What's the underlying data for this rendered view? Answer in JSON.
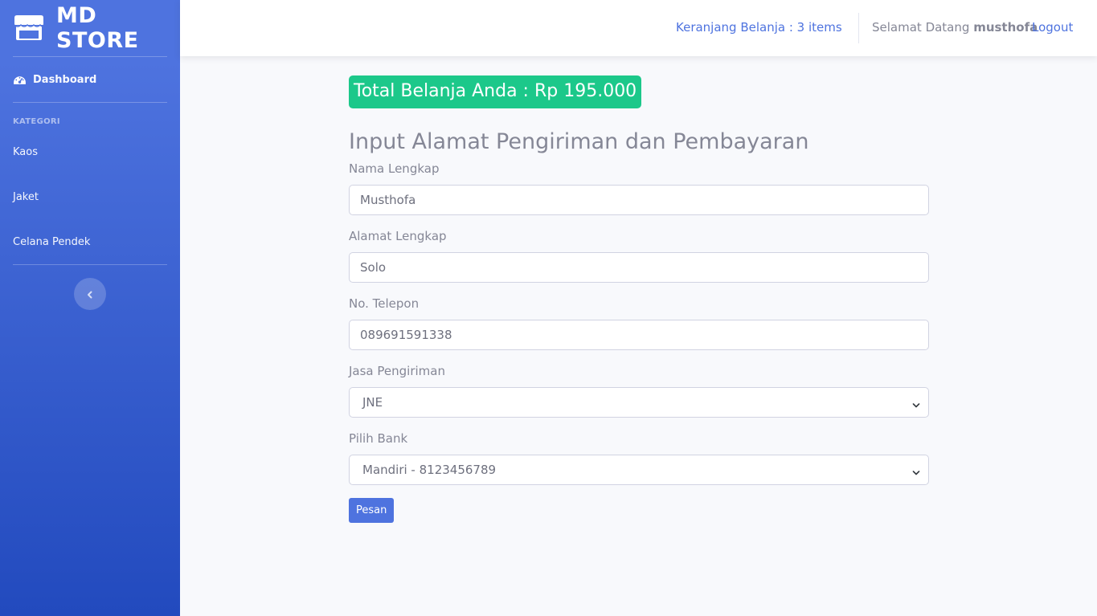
{
  "brand": {
    "name": "MD STORE",
    "icon": "store-icon"
  },
  "sidebar": {
    "dashboard": {
      "label": "Dashboard",
      "icon": "tachometer-icon"
    },
    "heading": "KATEGORI",
    "categories": [
      {
        "label": "Kaos"
      },
      {
        "label": "Jaket"
      },
      {
        "label": "Celana Pendek"
      }
    ],
    "toggle_icon": "chevron-left-icon"
  },
  "topbar": {
    "cart_label": "Keranjang Belanja : 3 items",
    "greeting_prefix": "Selamat Datang",
    "username": "musthofa",
    "logout_label": "Logout"
  },
  "main": {
    "total_label": "Total Belanja Anda : Rp 195.000",
    "form_title": "Input Alamat Pengiriman dan Pembayaran",
    "fields": {
      "name": {
        "label": "Nama Lengkap",
        "value": "Musthofa"
      },
      "address": {
        "label": "Alamat Lengkap",
        "value": "Solo"
      },
      "phone": {
        "label": "No. Telepon",
        "value": "089691591338"
      },
      "courier": {
        "label": "Jasa Pengiriman",
        "value": "JNE"
      },
      "bank": {
        "label": "Pilih Bank",
        "value": "Mandiri - 8123456789"
      }
    },
    "submit_label": "Pesan"
  },
  "colors": {
    "primary": "#4e73df",
    "success": "#1cc88a",
    "text_muted": "#858796"
  }
}
